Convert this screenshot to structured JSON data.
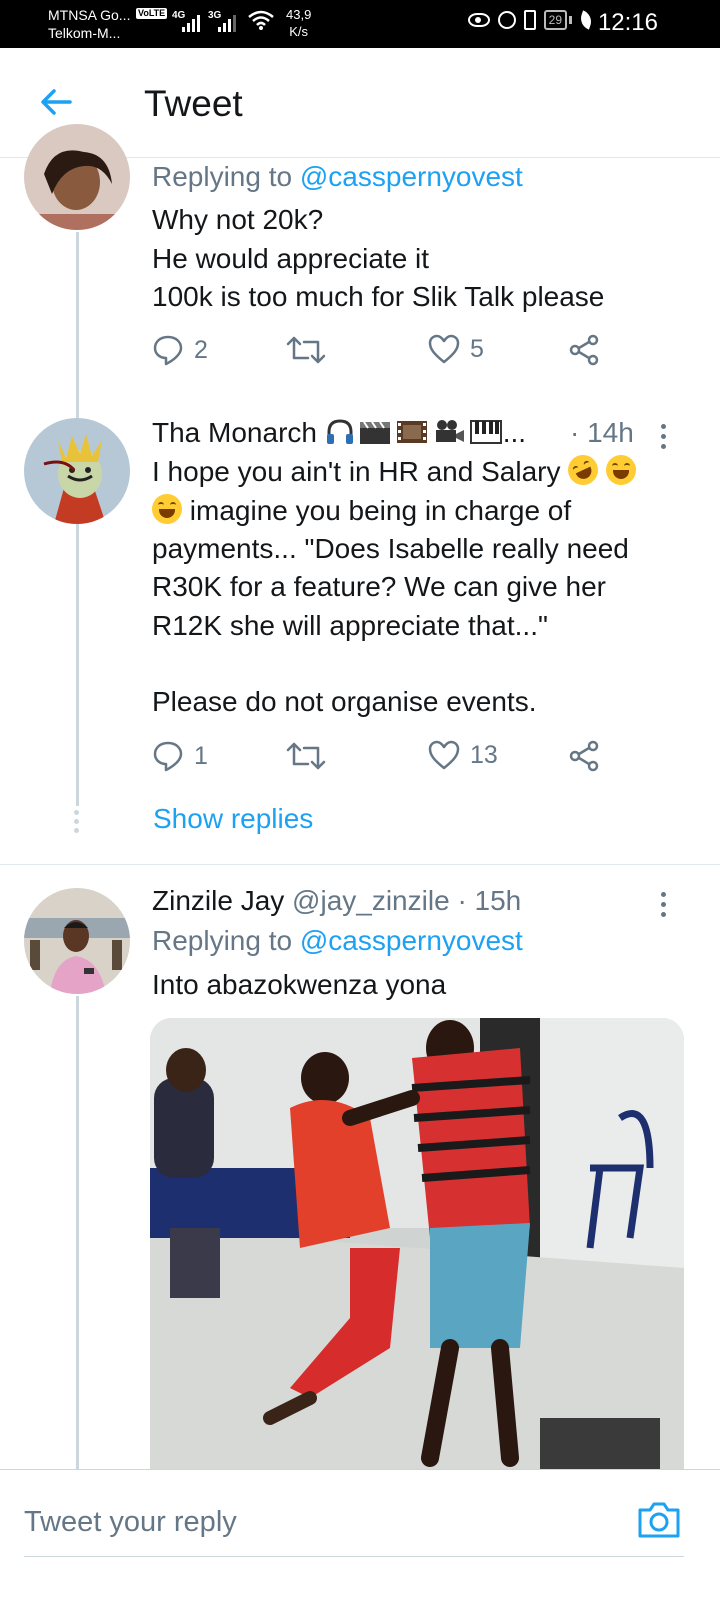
{
  "status_bar": {
    "carrier_1": "MTNSA Go...",
    "carrier_2": "Telkom-M...",
    "volte": "VoLTE",
    "net_1": "4G",
    "net_2": "3G",
    "speed_value": "43,9",
    "speed_unit": "K/s",
    "battery": "29",
    "time": "12:16"
  },
  "header": {
    "title": "Tweet"
  },
  "tweets": [
    {
      "replying_prefix": "Replying to",
      "replying_handle": "@casspernyovest",
      "lines": [
        "Why not 20k?",
        "He would appreciate it",
        "100k is too much for Slik Talk please"
      ],
      "replies": "2",
      "likes": "5"
    },
    {
      "name": "Tha Monarch",
      "name_suffix": "...",
      "time": "· 14h",
      "line_1": "I hope you ain't in HR and Salary",
      "line_2": "imagine you being in charge of",
      "line_3": "payments... \"Does Isabelle really need",
      "line_4": "R30K for a feature? We can give her",
      "line_5": "R12K she will appreciate that...\"",
      "line_6": "Please do not organise events.",
      "replies": "1",
      "likes": "13",
      "show_replies": "Show replies"
    },
    {
      "name": "Zinzile Jay",
      "handle": "@jay_zinzile",
      "time": "· 15h",
      "replying_prefix": "Replying to",
      "replying_handle": "@casspernyovest",
      "text": "Into abazokwenza yona"
    }
  ],
  "composer": {
    "placeholder": "Tweet your reply"
  },
  "colors": {
    "accent": "#1da1f2",
    "muted": "#657786",
    "text": "#14171a",
    "divider": "#e1e8ed"
  },
  "icons": [
    "back-arrow-icon",
    "reply-icon",
    "retweet-icon",
    "like-icon",
    "share-icon",
    "more-icon",
    "camera-icon"
  ]
}
